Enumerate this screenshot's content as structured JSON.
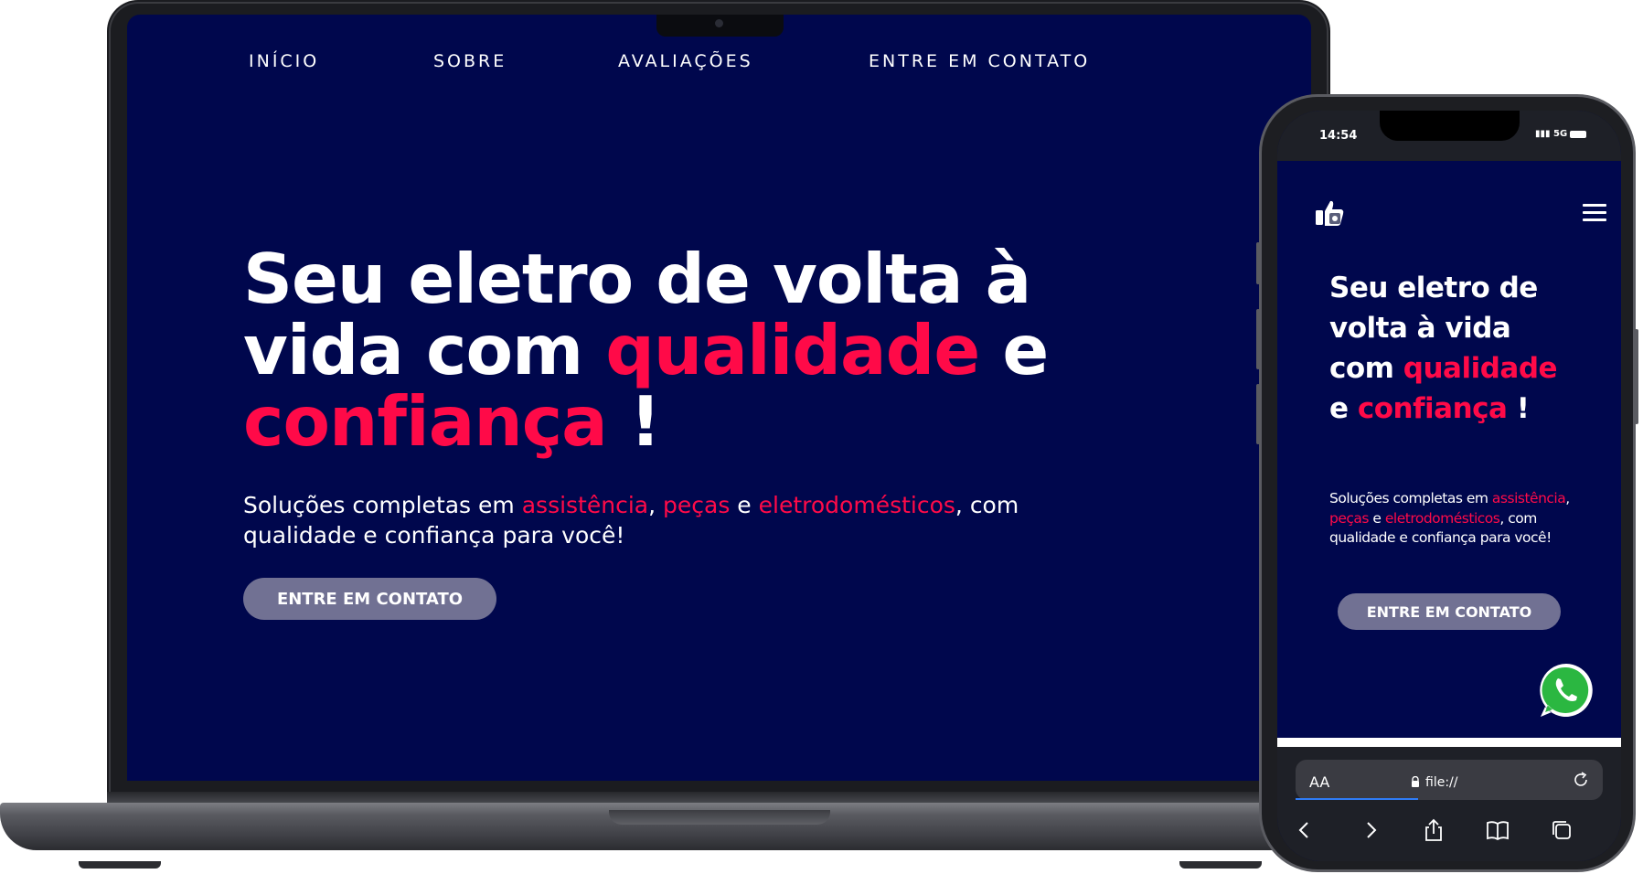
{
  "desktop": {
    "nav": [
      "INÍCIO",
      "SOBRE",
      "AVALIAÇÕES",
      "ENTRE EM CONTATO"
    ],
    "hero": {
      "title_part1": "Seu eletro de volta à vida com ",
      "title_accent1": "qualidade",
      "title_part2": " e ",
      "title_accent2": "confiança",
      "title_end": " !",
      "sub_part1": "Soluções completas em ",
      "sub_accent1": "assistência",
      "sub_sep1": ", ",
      "sub_accent2": "peças",
      "sub_sep2": " e ",
      "sub_accent3": "eletrodomésticos",
      "sub_part2": ", com qualidade e confiança para você!",
      "cta": "ENTRE EM CONTATO"
    }
  },
  "mobile": {
    "status": {
      "time": "14:54",
      "network": "5G"
    },
    "logo_icon": "thumbs-up-logo-icon",
    "menu_icon": "hamburger-menu-icon",
    "hero": {
      "title_part1": "Seu eletro de volta à vida com ",
      "title_accent1": "qualidade",
      "title_part2": " e ",
      "title_accent2": "confiança",
      "title_end": " !",
      "sub_part1": "Soluções completas em ",
      "sub_accent1": "assistência",
      "sub_sep1": ", ",
      "sub_accent2": "peças",
      "sub_sep2": " e ",
      "sub_accent3": "eletrodomésticos",
      "sub_part2": ", com qualidade e confiança para você!",
      "cta": "ENTRE EM CONTATO"
    },
    "whatsapp_icon": "whatsapp-icon",
    "browser": {
      "aa_label": "AA",
      "url": "file://"
    }
  },
  "colors": {
    "background": "#00074d",
    "accent": "#ff0a48",
    "button": "#717193"
  }
}
